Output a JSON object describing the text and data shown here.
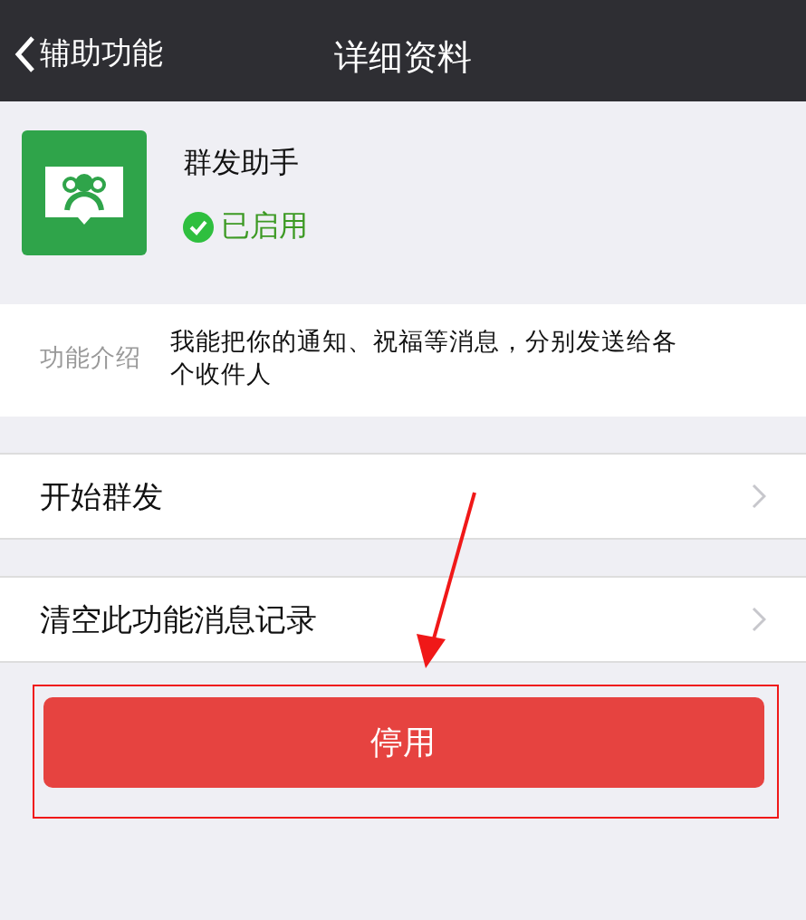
{
  "nav": {
    "back_label": "辅助功能",
    "title": "详细资料"
  },
  "plugin": {
    "name": "群发助手",
    "status": "已启用",
    "enabled": true
  },
  "intro": {
    "label": "功能介绍",
    "text": "我能把你的通知、祝福等消息，分别发送给各个收件人"
  },
  "rows": [
    {
      "label": "开始群发"
    },
    {
      "label": "清空此功能消息记录"
    }
  ],
  "button": {
    "label": "停用"
  }
}
